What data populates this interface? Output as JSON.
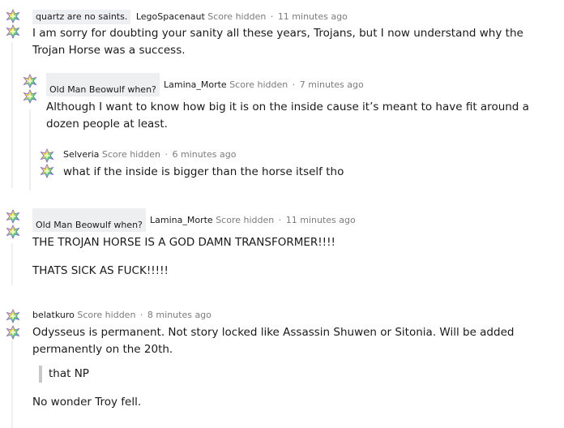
{
  "comments": [
    {
      "flair": "quartz are no saints.",
      "user": "LegoSpacenaut",
      "score": "Score hidden",
      "time": "11 minutes ago",
      "body": [
        "I am sorry for doubting your sanity all these years, Trojans, but I now understand why the Trojan Horse was a success."
      ]
    },
    {
      "flair": "Old Man Beowulf when?",
      "user": "Lamina_Morte",
      "score": "Score hidden",
      "time": "7 minutes ago",
      "body": [
        "Although I want to know how big it is on the inside cause it’s meant to have fit around a dozen people at least."
      ]
    },
    {
      "user": "Selveria",
      "score": "Score hidden",
      "time": "6 minutes ago",
      "body": [
        "what if the inside is bigger than the horse itself tho"
      ]
    },
    {
      "flair": "Old Man Beowulf when?",
      "user": "Lamina_Morte",
      "score": "Score hidden",
      "time": "11 minutes ago",
      "body": [
        "THE TROJAN HORSE IS A GOD DAMN TRANSFORMER!!!!",
        "THATS SICK AS FUCK!!!!!"
      ]
    },
    {
      "user": "belatkuro",
      "score": "Score hidden",
      "time": "8 minutes ago",
      "body": [
        "Odysseus is permanent. Not story locked like Assassin Shuwen or Sitonia. Will be added permanently on the 20th.",
        "that NP",
        "No wonder Troy fell."
      ]
    }
  ],
  "separator": "·",
  "icons": {
    "upvote": "upvote-star-icon",
    "downvote": "downvote-star-icon"
  },
  "colors": {
    "meta": "#7c7c7c",
    "flair_bg": "#edeff1",
    "thread_line": "#edeff1",
    "quote_bar": "#c8c8c8"
  }
}
